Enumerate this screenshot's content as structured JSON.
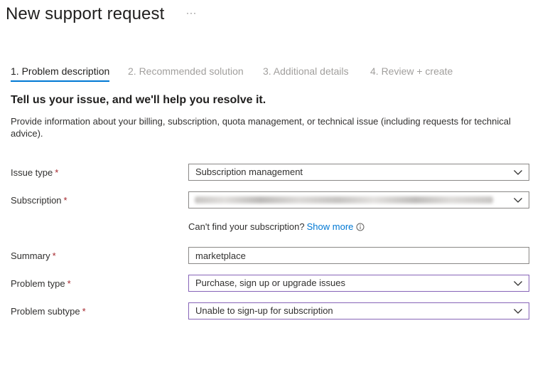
{
  "header": {
    "title": "New support request",
    "more_label": "···"
  },
  "tabs": [
    {
      "label": "1. Problem description",
      "active": true
    },
    {
      "label": "2. Recommended solution",
      "active": false
    },
    {
      "label": "3. Additional details",
      "active": false
    },
    {
      "label": "4. Review + create",
      "active": false
    }
  ],
  "intro": {
    "heading": "Tell us your issue, and we'll help you resolve it.",
    "description": "Provide information about your billing, subscription, quota management, or technical issue (including requests for technical advice)."
  },
  "form": {
    "required_mark": "*",
    "issue_type": {
      "label": "Issue type",
      "value": "Subscription management"
    },
    "subscription": {
      "label": "Subscription",
      "value": ""
    },
    "subscription_hint": {
      "text": "Can't find your subscription?",
      "link": "Show more"
    },
    "summary": {
      "label": "Summary",
      "value": "marketplace"
    },
    "problem_type": {
      "label": "Problem type",
      "value": "Purchase, sign up or upgrade issues"
    },
    "problem_subtype": {
      "label": "Problem subtype",
      "value": "Unable to sign-up for subscription"
    }
  },
  "colors": {
    "accent": "#0078d4",
    "required": "#a4262c",
    "focus_border": "#8764b8"
  },
  "icons": {
    "dropdown": "chevron-down-icon",
    "info": "info-icon"
  }
}
